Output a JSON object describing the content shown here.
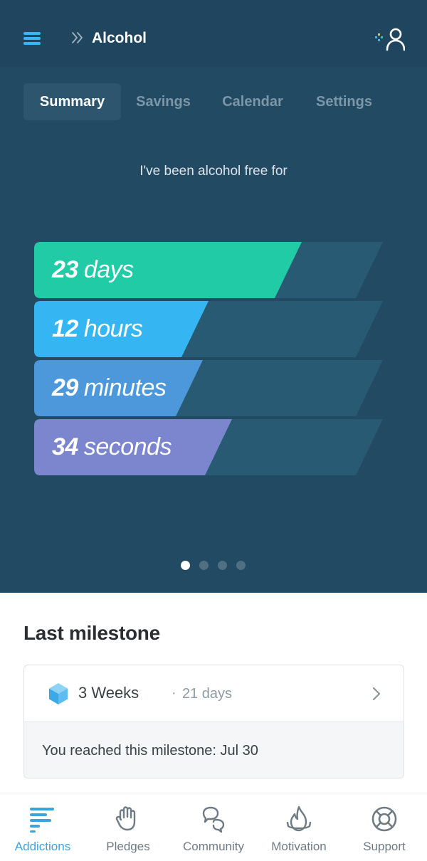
{
  "header": {
    "title": "Alcohol"
  },
  "tabs": [
    {
      "label": "Summary",
      "active": true
    },
    {
      "label": "Savings",
      "active": false
    },
    {
      "label": "Calendar",
      "active": false
    },
    {
      "label": "Settings",
      "active": false
    }
  ],
  "summary": {
    "intro": "I've been alcohol free for",
    "counters": [
      {
        "value": "23",
        "unit": "days",
        "color": "#20cba6",
        "fill_fraction": 0.767
      },
      {
        "value": "12",
        "unit": "hours",
        "color": "#35b6f2",
        "fill_fraction": 0.5
      },
      {
        "value": "29",
        "unit": "minutes",
        "color": "#4d98db",
        "fill_fraction": 0.483
      },
      {
        "value": "34",
        "unit": "seconds",
        "color": "#7b86cf",
        "fill_fraction": 0.567
      }
    ],
    "page_dots": {
      "count": 4,
      "active_index": 0
    }
  },
  "milestone": {
    "section_title": "Last milestone",
    "name": "3 Weeks",
    "separator": "·",
    "days": "21 days",
    "reached_text": "You reached this milestone: Jul 30"
  },
  "nav": [
    {
      "label": "Addictions",
      "icon": "addictions-icon",
      "active": true
    },
    {
      "label": "Pledges",
      "icon": "hand-icon",
      "active": false
    },
    {
      "label": "Community",
      "icon": "chat-icon",
      "active": false
    },
    {
      "label": "Motivation",
      "icon": "flame-icon",
      "active": false
    },
    {
      "label": "Support",
      "icon": "lifebuoy-icon",
      "active": false
    }
  ],
  "colors": {
    "header_bg": "#1f465e",
    "panel_bg": "#224a62",
    "accent": "#3ab4f2"
  }
}
